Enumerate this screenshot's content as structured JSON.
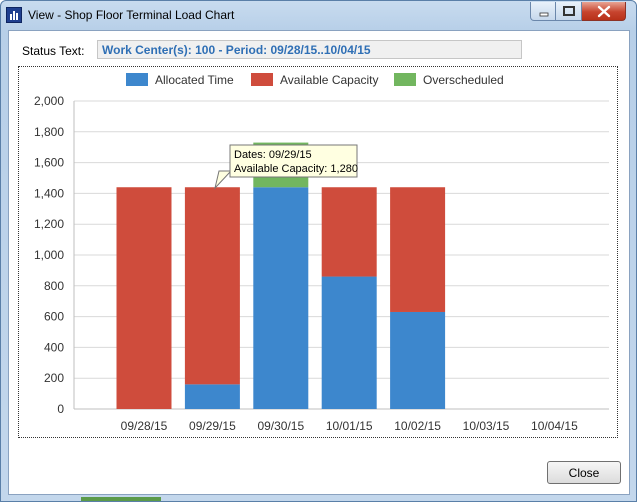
{
  "window": {
    "title": "View - Shop Floor Terminal Load Chart"
  },
  "status": {
    "label": "Status Text:",
    "value": "Work Center(s): 100 - Period: 09/28/15..10/04/15"
  },
  "buttons": {
    "close_label": "Close"
  },
  "tooltip": {
    "line1": "Dates: 09/29/15",
    "line2": "Available Capacity: 1,280"
  },
  "colors": {
    "allocated": "#3d87cd",
    "available": "#cf4c3c",
    "overscheduled": "#72b65f"
  },
  "chart_data": {
    "type": "bar",
    "stacked": true,
    "categories": [
      "09/28/15",
      "09/29/15",
      "09/30/15",
      "10/01/15",
      "10/02/15",
      "10/03/15",
      "10/04/15"
    ],
    "series": [
      {
        "name": "Allocated Time",
        "values": [
          0,
          160,
          1440,
          860,
          630,
          0,
          0
        ]
      },
      {
        "name": "Available Capacity",
        "values": [
          1440,
          1280,
          0,
          580,
          810,
          0,
          0
        ]
      },
      {
        "name": "Overscheduled",
        "values": [
          0,
          0,
          290,
          0,
          0,
          0,
          0
        ]
      }
    ],
    "ylim": [
      0,
      2000
    ],
    "yticks": [
      "0",
      "200",
      "400",
      "600",
      "800",
      "1,000",
      "1,200",
      "1,400",
      "1,600",
      "1,800",
      "2,000"
    ],
    "grid": true,
    "legend_position": "top"
  }
}
